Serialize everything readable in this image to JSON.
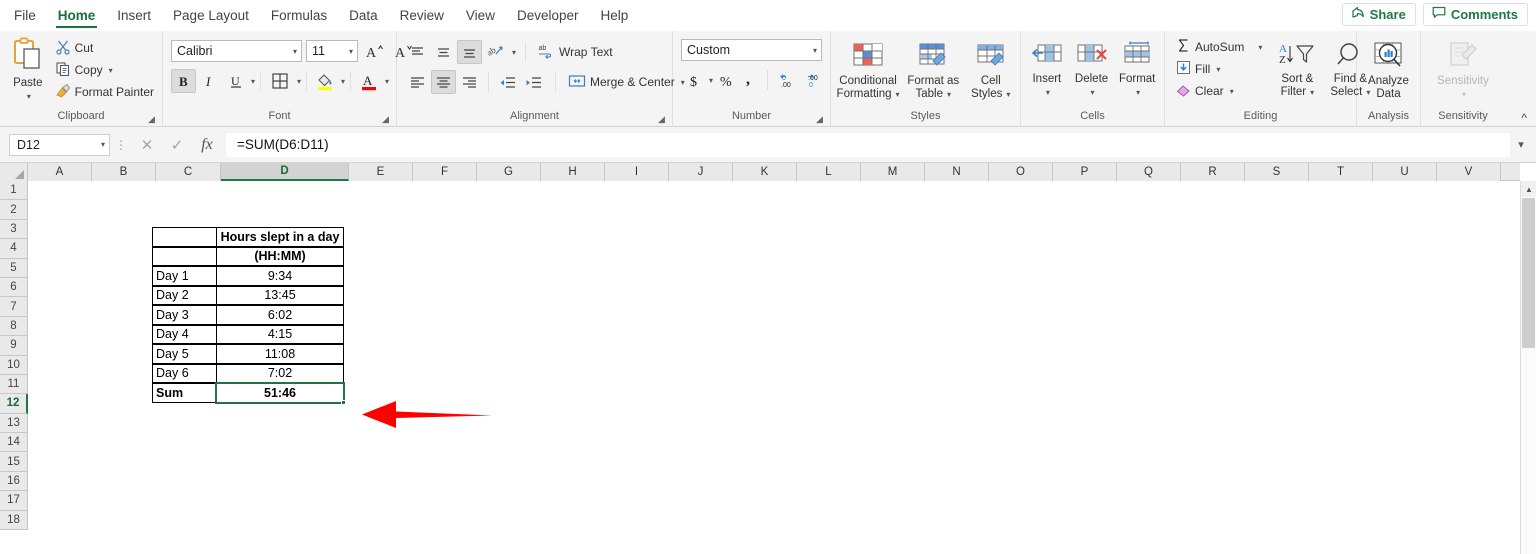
{
  "tabs": [
    {
      "label": "File",
      "active": false
    },
    {
      "label": "Home",
      "active": true
    },
    {
      "label": "Insert",
      "active": false
    },
    {
      "label": "Page Layout",
      "active": false
    },
    {
      "label": "Formulas",
      "active": false
    },
    {
      "label": "Data",
      "active": false
    },
    {
      "label": "Review",
      "active": false
    },
    {
      "label": "View",
      "active": false
    },
    {
      "label": "Developer",
      "active": false
    },
    {
      "label": "Help",
      "active": false
    }
  ],
  "titlebar_right": {
    "share_label": "Share",
    "comments_label": "Comments"
  },
  "ribbon": {
    "clipboard": {
      "group_label": "Clipboard",
      "paste_label": "Paste",
      "cut_label": "Cut",
      "copy_label": "Copy",
      "format_painter_label": "Format Painter"
    },
    "font": {
      "group_label": "Font",
      "font_name": "Calibri",
      "font_size": "11",
      "bold_active": true
    },
    "alignment": {
      "group_label": "Alignment",
      "wrap_text_label": "Wrap Text",
      "merge_center_label": "Merge & Center"
    },
    "number": {
      "group_label": "Number",
      "format_value": "Custom"
    },
    "styles": {
      "group_label": "Styles",
      "conditional_formatting_label": "Conditional\nFormatting",
      "conditional_formatting_l1": "Conditional",
      "conditional_formatting_l2": "Formatting",
      "format_as_table_l1": "Format as",
      "format_as_table_l2": "Table",
      "cell_styles_l1": "Cell",
      "cell_styles_l2": "Styles"
    },
    "cells": {
      "group_label": "Cells",
      "insert_label": "Insert",
      "delete_label": "Delete",
      "format_label": "Format"
    },
    "editing": {
      "group_label": "Editing",
      "autosum_label": "AutoSum",
      "fill_label": "Fill",
      "clear_label": "Clear",
      "sort_filter_l1": "Sort &",
      "sort_filter_l2": "Filter",
      "find_select_l1": "Find &",
      "find_select_l2": "Select"
    },
    "analysis": {
      "group_label": "Analysis",
      "analyze_data_l1": "Analyze",
      "analyze_data_l2": "Data"
    },
    "sensitivity": {
      "group_label": "Sensitivity",
      "sensitivity_label": "Sensitivity",
      "disabled": true
    },
    "collapse_icon": "chevron-up-icon"
  },
  "formula_bar": {
    "name_box_value": "D12",
    "formula_value": "=SUM(D6:D11)",
    "cancel_icon": "close-icon",
    "enter_icon": "check-icon",
    "insert_function_icon": "fx-icon",
    "expand_icon": "chevron-down-icon"
  },
  "grid": {
    "columns": [
      "A",
      "B",
      "C",
      "D",
      "E",
      "F",
      "G",
      "H",
      "I",
      "J",
      "K",
      "L",
      "M",
      "N",
      "O",
      "P",
      "Q",
      "R",
      "S",
      "T",
      "U",
      "V"
    ],
    "selected_column": "D",
    "rows": [
      1,
      2,
      3,
      4,
      5,
      6,
      7,
      8,
      9,
      10,
      11,
      12,
      13,
      14,
      15,
      16,
      17,
      18
    ],
    "selected_row": 12,
    "selected_cell": "D12"
  },
  "sheet_table": {
    "header_c4": "",
    "header_d4": "Hours slept in a day",
    "header_c5": "",
    "header_d5": "(HH:MM)",
    "rows": [
      {
        "label": "Day 1",
        "value": "9:34"
      },
      {
        "label": "Day 2",
        "value": "13:45"
      },
      {
        "label": "Day 3",
        "value": "6:02"
      },
      {
        "label": "Day 4",
        "value": "4:15"
      },
      {
        "label": "Day 5",
        "value": "11:08"
      },
      {
        "label": "Day 6",
        "value": "7:02"
      }
    ],
    "total_label": "Sum",
    "total_value": "51:46"
  },
  "annotation": {
    "shape": "left-arrow",
    "color": "#FF0000"
  },
  "colors": {
    "accent_green": "#217346",
    "ribbon_bg": "#f4f4f4",
    "header_bg": "#e9e9e9",
    "annotation_red": "#FF0000"
  }
}
